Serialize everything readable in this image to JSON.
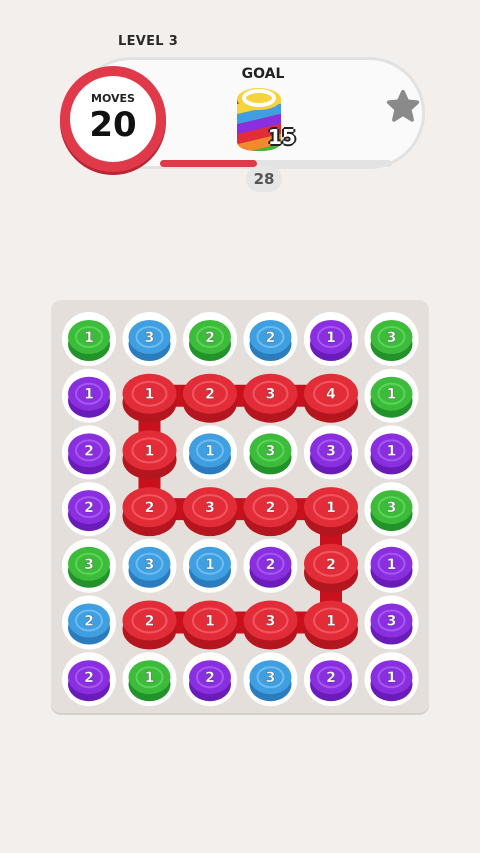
{
  "header": {
    "level_label": "LEVEL 3",
    "moves_label": "MOVES",
    "moves_value": "20",
    "goal_label": "GOAL",
    "goal_count": "15",
    "score_value": "28",
    "progress_fraction": 0.42
  },
  "colors": {
    "green": "#3dbb3a",
    "blue": "#3f9fe0",
    "purple": "#8a2fe0",
    "red": "#e22d38",
    "accent": "#e0394a",
    "board": "#e4dfda"
  },
  "icons": {
    "goal": "rainbow-stack-icon",
    "reward": "star-icon"
  },
  "board": {
    "rows": 7,
    "cols": 6,
    "cells": [
      [
        {
          "c": "green",
          "n": "1"
        },
        {
          "c": "blue",
          "n": "3"
        },
        {
          "c": "green",
          "n": "2"
        },
        {
          "c": "blue",
          "n": "2"
        },
        {
          "c": "purple",
          "n": "1"
        },
        {
          "c": "green",
          "n": "3"
        }
      ],
      [
        {
          "c": "purple",
          "n": "1"
        },
        {
          "c": "red",
          "n": "1"
        },
        {
          "c": "red",
          "n": "2"
        },
        {
          "c": "red",
          "n": "3"
        },
        {
          "c": "red",
          "n": "4"
        },
        {
          "c": "green",
          "n": "1"
        }
      ],
      [
        {
          "c": "purple",
          "n": "2"
        },
        {
          "c": "red",
          "n": "1"
        },
        {
          "c": "blue",
          "n": "1"
        },
        {
          "c": "green",
          "n": "3"
        },
        {
          "c": "purple",
          "n": "3"
        },
        {
          "c": "purple",
          "n": "1"
        }
      ],
      [
        {
          "c": "purple",
          "n": "2"
        },
        {
          "c": "red",
          "n": "2"
        },
        {
          "c": "red",
          "n": "3"
        },
        {
          "c": "red",
          "n": "2"
        },
        {
          "c": "red",
          "n": "1"
        },
        {
          "c": "green",
          "n": "3"
        }
      ],
      [
        {
          "c": "green",
          "n": "3"
        },
        {
          "c": "blue",
          "n": "3"
        },
        {
          "c": "blue",
          "n": "1"
        },
        {
          "c": "purple",
          "n": "2"
        },
        {
          "c": "red",
          "n": "2"
        },
        {
          "c": "purple",
          "n": "1"
        }
      ],
      [
        {
          "c": "blue",
          "n": "2"
        },
        {
          "c": "red",
          "n": "2"
        },
        {
          "c": "red",
          "n": "1"
        },
        {
          "c": "red",
          "n": "3"
        },
        {
          "c": "red",
          "n": "1"
        },
        {
          "c": "purple",
          "n": "3"
        }
      ],
      [
        {
          "c": "purple",
          "n": "2"
        },
        {
          "c": "green",
          "n": "1"
        },
        {
          "c": "purple",
          "n": "2"
        },
        {
          "c": "blue",
          "n": "3"
        },
        {
          "c": "purple",
          "n": "2"
        },
        {
          "c": "purple",
          "n": "1"
        }
      ]
    ],
    "path": [
      [
        1,
        4
      ],
      [
        1,
        3
      ],
      [
        1,
        2
      ],
      [
        1,
        1
      ],
      [
        2,
        1
      ],
      [
        3,
        1
      ],
      [
        3,
        2
      ],
      [
        3,
        3
      ],
      [
        3,
        4
      ],
      [
        4,
        4
      ],
      [
        5,
        4
      ],
      [
        5,
        3
      ],
      [
        5,
        2
      ],
      [
        5,
        1
      ]
    ]
  }
}
